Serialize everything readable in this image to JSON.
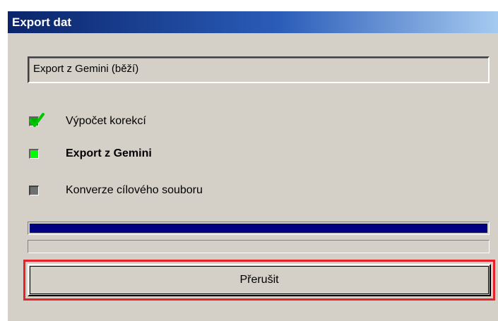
{
  "window": {
    "title": "Export dat"
  },
  "status": {
    "text": "Export z Gemini (běží)"
  },
  "steps": [
    {
      "label": "Výpočet korekcí",
      "state": "done",
      "icon": "checkmark-icon",
      "color": "#00b000"
    },
    {
      "label": "Export z Gemini",
      "state": "active",
      "icon": "active-step-icon",
      "color": "#00ff00"
    },
    {
      "label": "Konverze cílového souboru",
      "state": "pending",
      "icon": "pending-step-icon",
      "color": "#707070"
    }
  ],
  "progress": {
    "overall_fraction": 1.0,
    "step_fraction": 0.0,
    "color": "#000080"
  },
  "buttons": {
    "abort_label": "Přerušit",
    "highlight_color": "#e8202a"
  }
}
